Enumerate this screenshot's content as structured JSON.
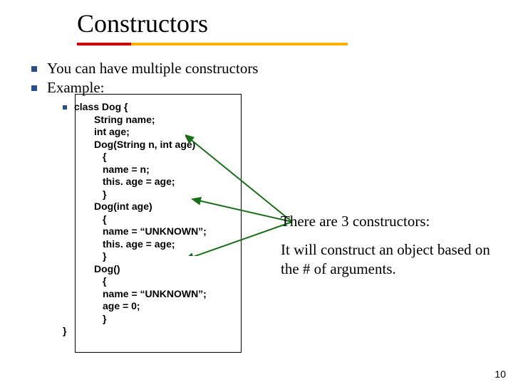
{
  "title": "Constructors",
  "bullets": {
    "b1": "You can have multiple constructors",
    "b2": "Example:"
  },
  "code": {
    "l0": "class Dog {",
    "l1": "String name;",
    "l2": "int age;",
    "l3": "Dog(String n, int age)",
    "l4": "{",
    "l5": "name = n;",
    "l6": "this. age = age;",
    "l7": "}",
    "l8": "Dog(int age)",
    "l9": "{",
    "l10": "name = “UNKNOWN”;",
    "l11": "this. age = age;",
    "l12": "}",
    "l13": "Dog()",
    "l14": "{",
    "l15": "name = “UNKNOWN”;",
    "l16": "age = 0;",
    "l17": "}",
    "close": "}"
  },
  "notes": {
    "n1": "There are 3 constructors:",
    "n2": "It will construct an object based on the # of arguments."
  },
  "page": "10"
}
